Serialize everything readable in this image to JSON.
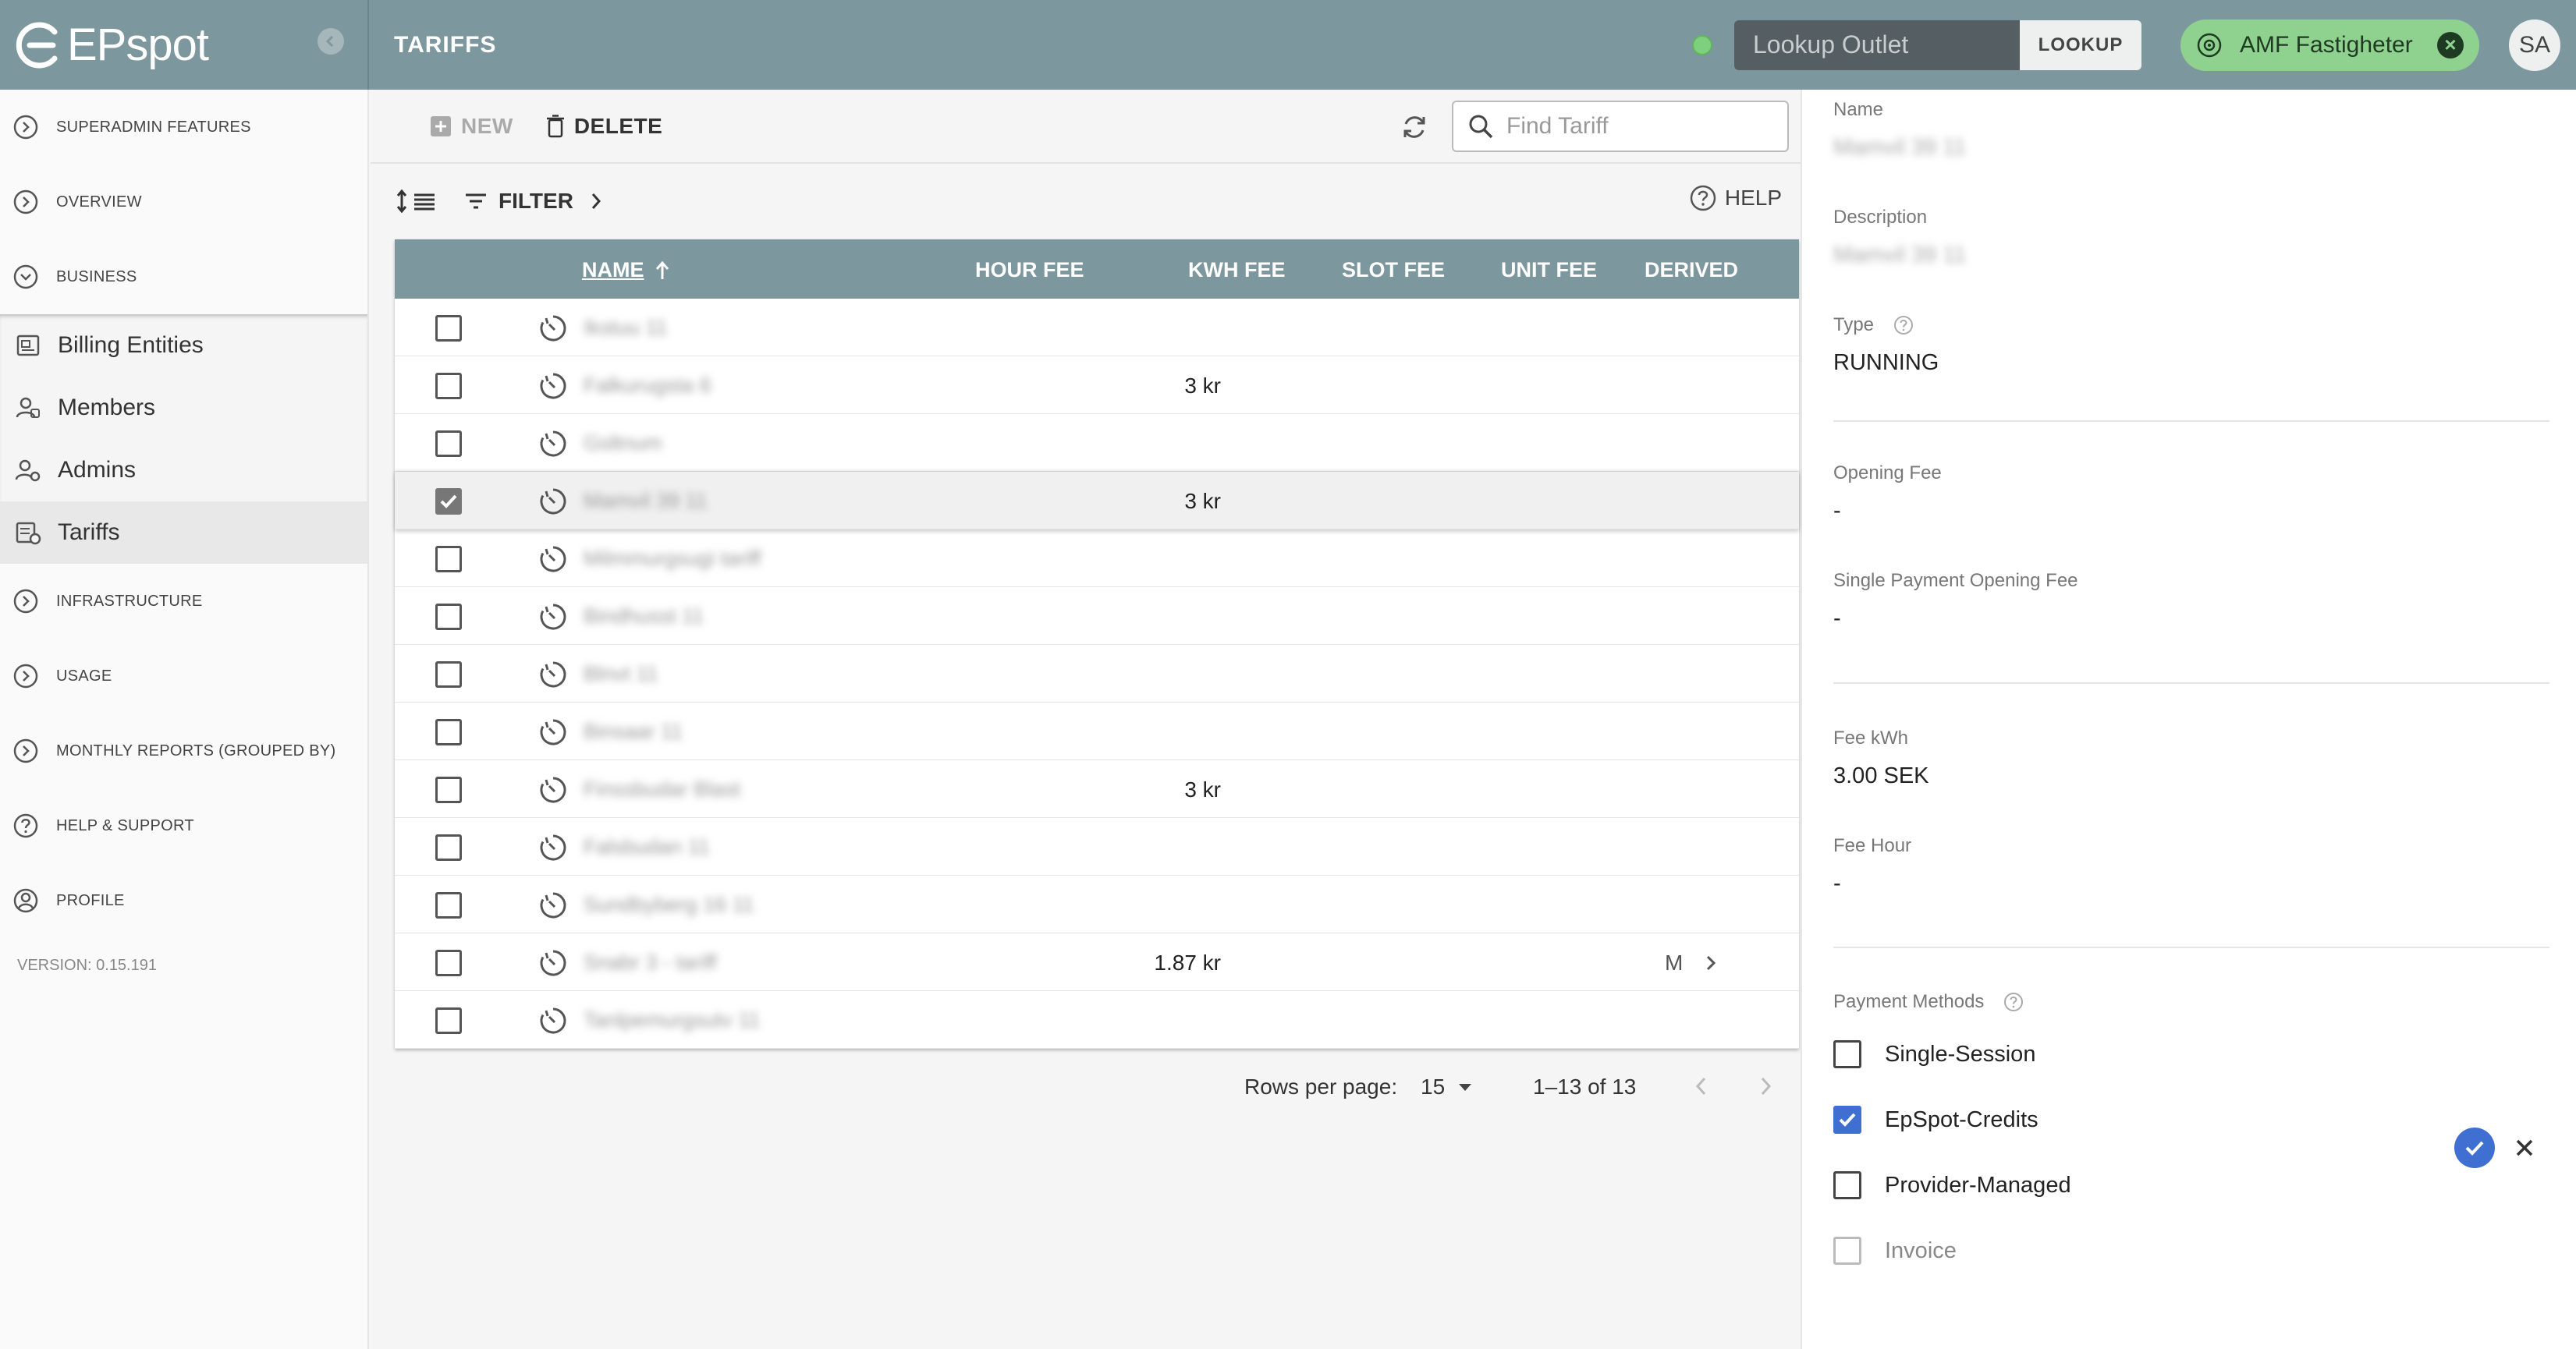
{
  "brand": {
    "name": "EPspot"
  },
  "header": {
    "page_title": "TARIFFS",
    "lookup_placeholder": "Lookup Outlet",
    "lookup_button": "LOOKUP",
    "chip_label": "AMF Fastigheter",
    "avatar_initials": "SA"
  },
  "sidebar": {
    "sections_top": [
      {
        "label": "SUPERADMIN FEATURES"
      },
      {
        "label": "OVERVIEW"
      },
      {
        "label": "BUSINESS"
      }
    ],
    "business_items": [
      {
        "label": "Billing Entities"
      },
      {
        "label": "Members"
      },
      {
        "label": "Admins"
      },
      {
        "label": "Tariffs"
      }
    ],
    "sections_bottom": [
      {
        "label": "INFRASTRUCTURE"
      },
      {
        "label": "USAGE"
      },
      {
        "label": "MONTHLY REPORTS (GROUPED BY)"
      },
      {
        "label": "HELP & SUPPORT"
      },
      {
        "label": "PROFILE"
      }
    ],
    "version": "VERSION: 0.15.191"
  },
  "toolbar": {
    "new_label": "NEW",
    "delete_label": "DELETE",
    "search_placeholder": "Find Tariff",
    "filter_label": "FILTER",
    "help_label": "HELP"
  },
  "table": {
    "columns": {
      "name": "NAME",
      "hour_fee": "HOUR FEE",
      "kwh_fee": "KWH FEE",
      "slot_fee": "SLOT FEE",
      "unit_fee": "UNIT FEE",
      "derived": "DERIVED"
    },
    "rows": [
      {
        "name": "Ikstuu 11",
        "kwh": "",
        "derived": "",
        "checked": false
      },
      {
        "name": "Falkurugsta 6",
        "kwh": "3 kr",
        "derived": "",
        "checked": false
      },
      {
        "name": "Gsltnum",
        "kwh": "",
        "derived": "",
        "checked": false
      },
      {
        "name": "Mamvil 39 11",
        "kwh": "3 kr",
        "derived": "",
        "checked": true
      },
      {
        "name": "Milmmurgsugi tariff",
        "kwh": "",
        "derived": "",
        "checked": false
      },
      {
        "name": "Bindhusst 11",
        "kwh": "",
        "derived": "",
        "checked": false
      },
      {
        "name": "Blnvt 11",
        "kwh": "",
        "derived": "",
        "checked": false
      },
      {
        "name": "Binsaar 11",
        "kwh": "",
        "derived": "",
        "checked": false
      },
      {
        "name": "Finssbudar Blast",
        "kwh": "3 kr",
        "derived": "",
        "checked": false
      },
      {
        "name": "Falsbudan 11",
        "kwh": "",
        "derived": "",
        "checked": false
      },
      {
        "name": "Sundbyberg 16 11",
        "kwh": "",
        "derived": "",
        "checked": false
      },
      {
        "name": "Snabr 3 - tariff",
        "kwh": "1.87 kr",
        "derived": "M",
        "checked": false
      },
      {
        "name": "Tanlpemurgsutv 11",
        "kwh": "",
        "derived": "",
        "checked": false
      }
    ]
  },
  "pagination": {
    "rows_per_page_label": "Rows per page:",
    "rows_per_page": "15",
    "range": "1–13 of 13"
  },
  "detail": {
    "name_label": "Name",
    "name_value": "Mamvil 39 11",
    "description_label": "Description",
    "description_value": "Mamvil 39 11",
    "type_label": "Type",
    "type_value": "RUNNING",
    "opening_fee_label": "Opening Fee",
    "opening_fee_value": "-",
    "single_payment_label": "Single Payment Opening Fee",
    "single_payment_value": "-",
    "fee_kwh_label": "Fee kWh",
    "fee_kwh_value": "3.00 SEK",
    "fee_hour_label": "Fee Hour",
    "fee_hour_value": "-",
    "payment_methods_label": "Payment Methods",
    "payment_methods": [
      {
        "label": "Single-Session",
        "checked": false,
        "disabled": false
      },
      {
        "label": "EpSpot-Credits",
        "checked": true,
        "disabled": false
      },
      {
        "label": "Provider-Managed",
        "checked": false,
        "disabled": false
      },
      {
        "label": "Invoice",
        "checked": false,
        "disabled": true
      }
    ]
  },
  "colors": {
    "header": "#7c979d",
    "accent": "#3f6fd1",
    "chip": "#8fd28f",
    "status": "#7ed07e"
  }
}
